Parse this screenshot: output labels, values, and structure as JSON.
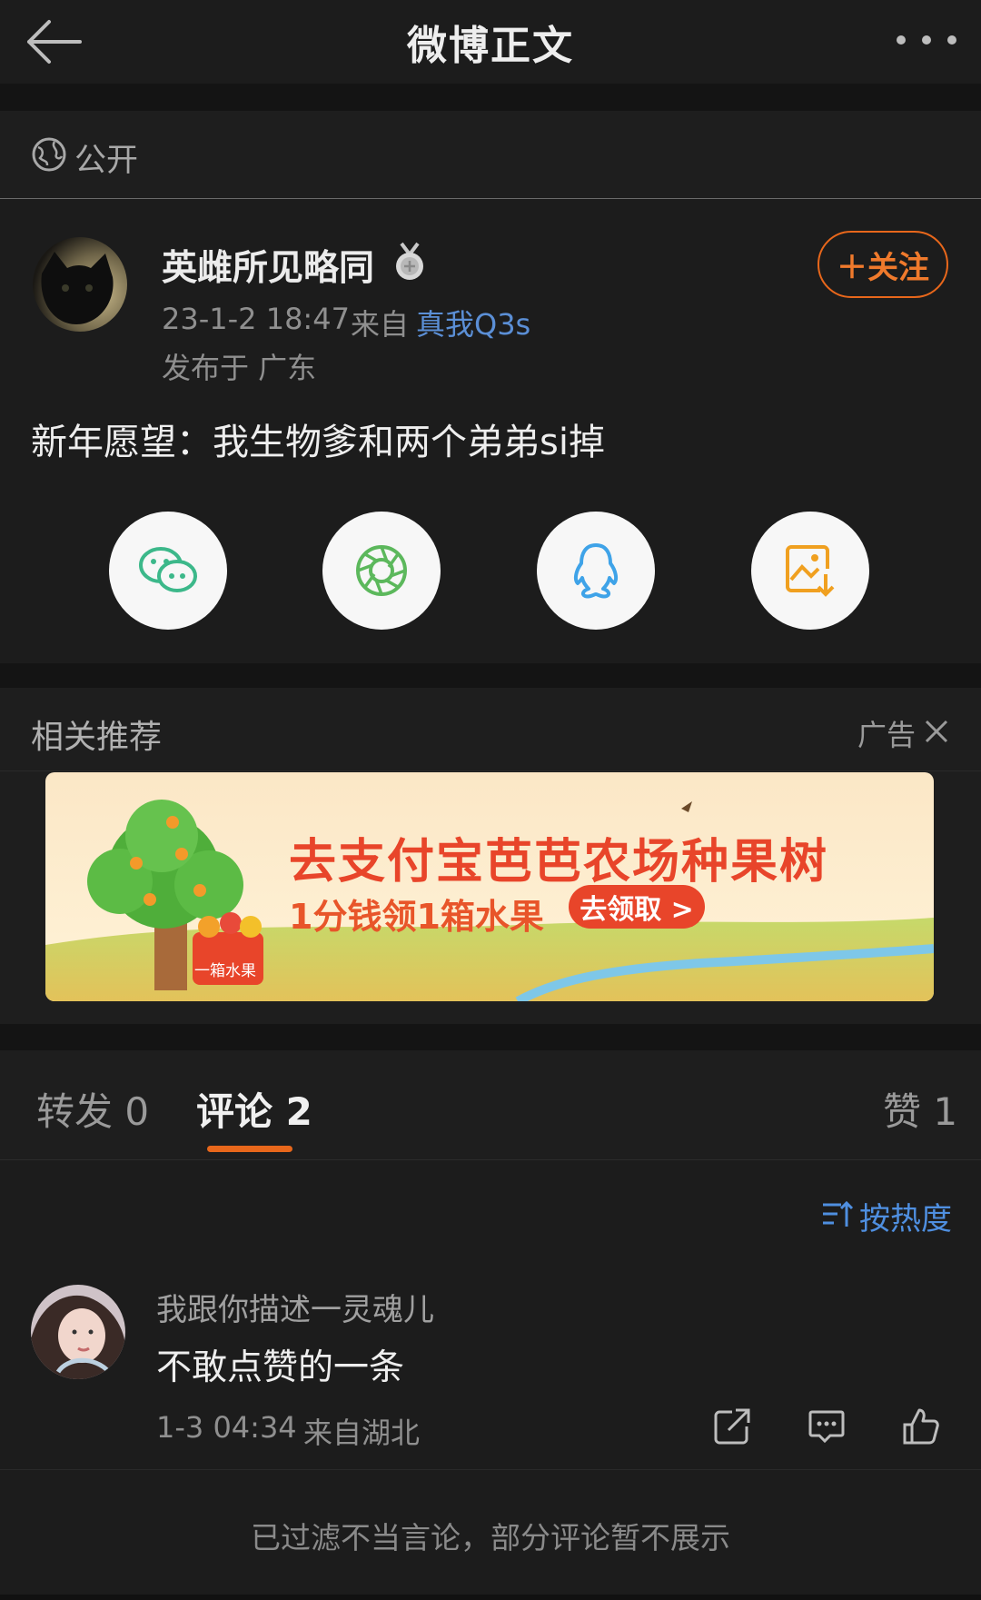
{
  "header": {
    "title": "微博正文"
  },
  "visibility": {
    "label": "公开"
  },
  "post": {
    "author": "英雌所见略同",
    "follow_label": "＋关注",
    "time": "23-1-2 18:47",
    "source_label": "来自",
    "device": "真我Q3s",
    "location": "发布于 广东",
    "text": "新年愿望：我生物爹和两个弟弟si掉"
  },
  "share": {
    "icons": [
      "wechat-icon",
      "moments-icon",
      "qq-icon",
      "save-image-icon"
    ]
  },
  "recommend": {
    "title": "相关推荐",
    "ad_label": "广告",
    "banner": {
      "headline": "去支付宝芭芭农场种果树",
      "subline": "1分钱领1箱水果",
      "cta": "去领取 >",
      "basket_label": "一箱水果"
    }
  },
  "tabs": {
    "repost": "转发 0",
    "comment": "评论 2",
    "like": "赞 1"
  },
  "sort": {
    "label": "按热度"
  },
  "comments": [
    {
      "user": "我跟你描述一灵魂儿",
      "text": "不敢点赞的一条",
      "time": "1-3 04:34",
      "location": "来自湖北"
    }
  ],
  "footer": {
    "notice": "已过滤不当言论，部分评论暂不展示"
  },
  "colors": {
    "accent": "#e8671b",
    "link": "#4f8fe0",
    "background": "#1c1c1c"
  }
}
